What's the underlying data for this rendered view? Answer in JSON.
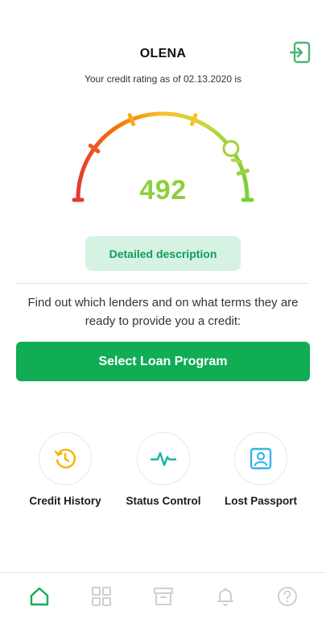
{
  "header": {
    "user_name": "OLENA",
    "rating_date_text": "Your credit rating as of 02.13.2020 is"
  },
  "gauge": {
    "score": "492",
    "fraction": 0.8,
    "colors": [
      "#e53935",
      "#f57c00",
      "#fbc02d",
      "#c6d93a",
      "#7ccf3b"
    ]
  },
  "detail_button": {
    "label": "Detailed description"
  },
  "info": {
    "text": "Find out which lenders and on what terms they are ready to provide you a credit:"
  },
  "primary_button": {
    "label": "Select Loan Program"
  },
  "services": [
    {
      "label": "Credit History",
      "icon": "history-icon",
      "color": "#f4b400"
    },
    {
      "label": "Status Control",
      "icon": "pulse-icon",
      "color": "#19b5a0"
    },
    {
      "label": "Lost Passport",
      "icon": "id-card-icon",
      "color": "#36b3e6"
    }
  ],
  "bottom_nav": [
    {
      "icon": "home-icon",
      "active": true
    },
    {
      "icon": "grid-icon",
      "active": false
    },
    {
      "icon": "archive-icon",
      "active": false
    },
    {
      "icon": "bell-icon",
      "active": false
    },
    {
      "icon": "help-icon",
      "active": false
    }
  ],
  "colors": {
    "accent": "#10ad55",
    "score": "#8ccf3d",
    "detail_bg": "#d5f2e3",
    "nav_active": "#10ad55",
    "nav_inactive": "#cfcfcf"
  }
}
